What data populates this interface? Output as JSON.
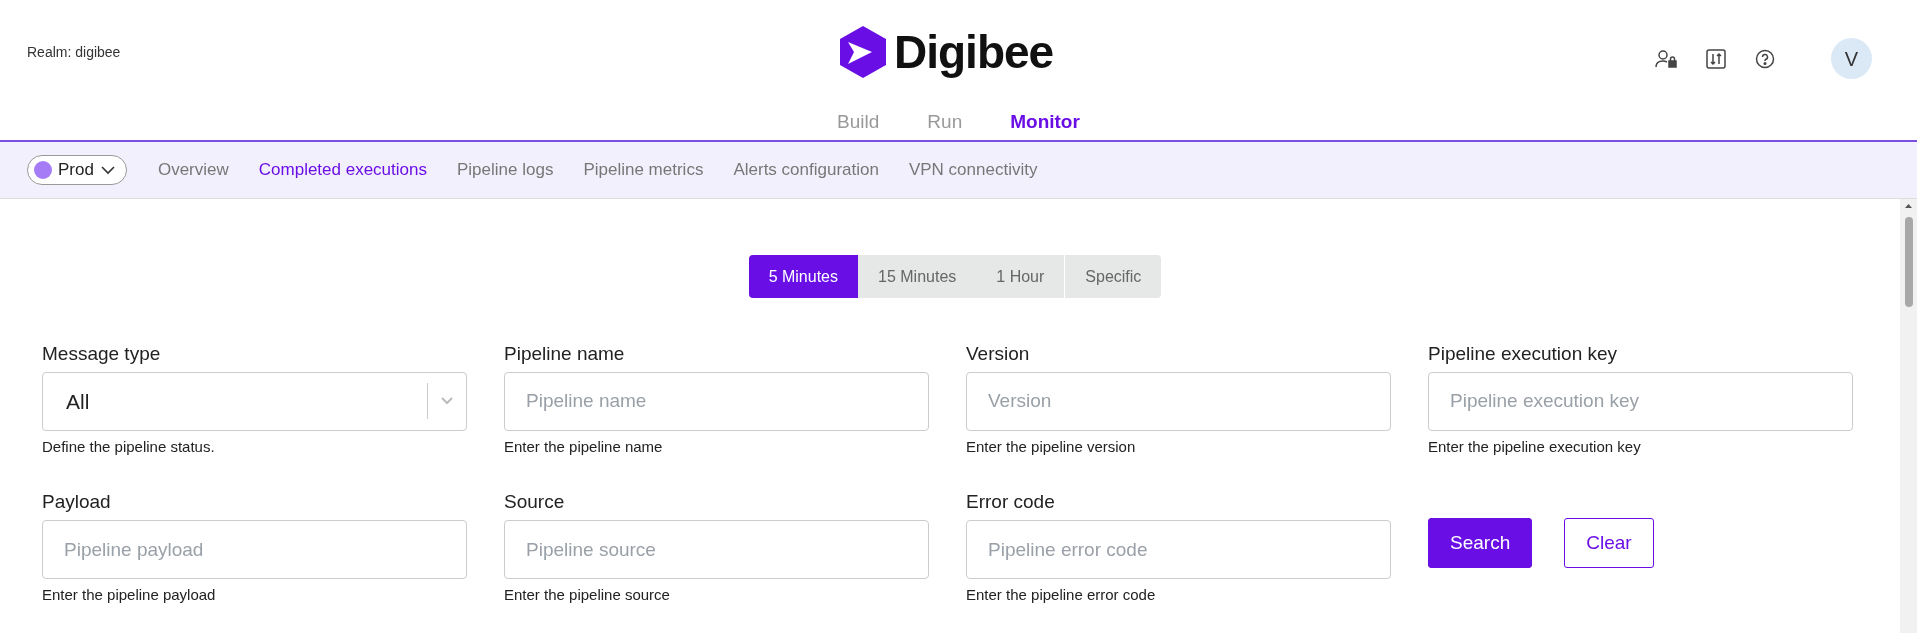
{
  "header": {
    "realm": "Realm: digibee",
    "logo_text": "Digibee",
    "avatar": "V"
  },
  "main_tabs": [
    {
      "label": "Build",
      "selected": false
    },
    {
      "label": "Run",
      "selected": false
    },
    {
      "label": "Monitor",
      "selected": true
    }
  ],
  "environment": {
    "label": "Prod"
  },
  "sub_tabs": [
    {
      "label": "Overview",
      "selected": false
    },
    {
      "label": "Completed executions",
      "selected": true
    },
    {
      "label": "Pipeline logs",
      "selected": false
    },
    {
      "label": "Pipeline metrics",
      "selected": false
    },
    {
      "label": "Alerts configuration",
      "selected": false
    },
    {
      "label": "VPN connectivity",
      "selected": false
    }
  ],
  "time_ranges": [
    {
      "label": "5 Minutes",
      "selected": true
    },
    {
      "label": "15 Minutes",
      "selected": false
    },
    {
      "label": "1 Hour",
      "selected": false
    },
    {
      "label": "Specific",
      "selected": false
    }
  ],
  "fields": [
    {
      "kind": "select",
      "label": "Message type",
      "value": "All",
      "help": "Define the pipeline status."
    },
    {
      "kind": "input",
      "label": "Pipeline name",
      "placeholder": "Pipeline name",
      "help": "Enter the pipeline name"
    },
    {
      "kind": "input",
      "label": "Version",
      "placeholder": "Version",
      "help": "Enter the pipeline version"
    },
    {
      "kind": "input",
      "label": "Pipeline execution key",
      "placeholder": "Pipeline execution key",
      "help": "Enter the pipeline execution key"
    },
    {
      "kind": "input",
      "label": "Payload",
      "placeholder": "Pipeline payload",
      "help": "Enter the pipeline payload"
    },
    {
      "kind": "input",
      "label": "Source",
      "placeholder": "Pipeline source",
      "help": "Enter the pipeline source"
    },
    {
      "kind": "input",
      "label": "Error code",
      "placeholder": "Pipeline error code",
      "help": "Enter the pipeline error code"
    }
  ],
  "buttons": [
    {
      "label": "Search",
      "kind": "primary"
    },
    {
      "label": "Clear",
      "kind": "outline"
    }
  ]
}
